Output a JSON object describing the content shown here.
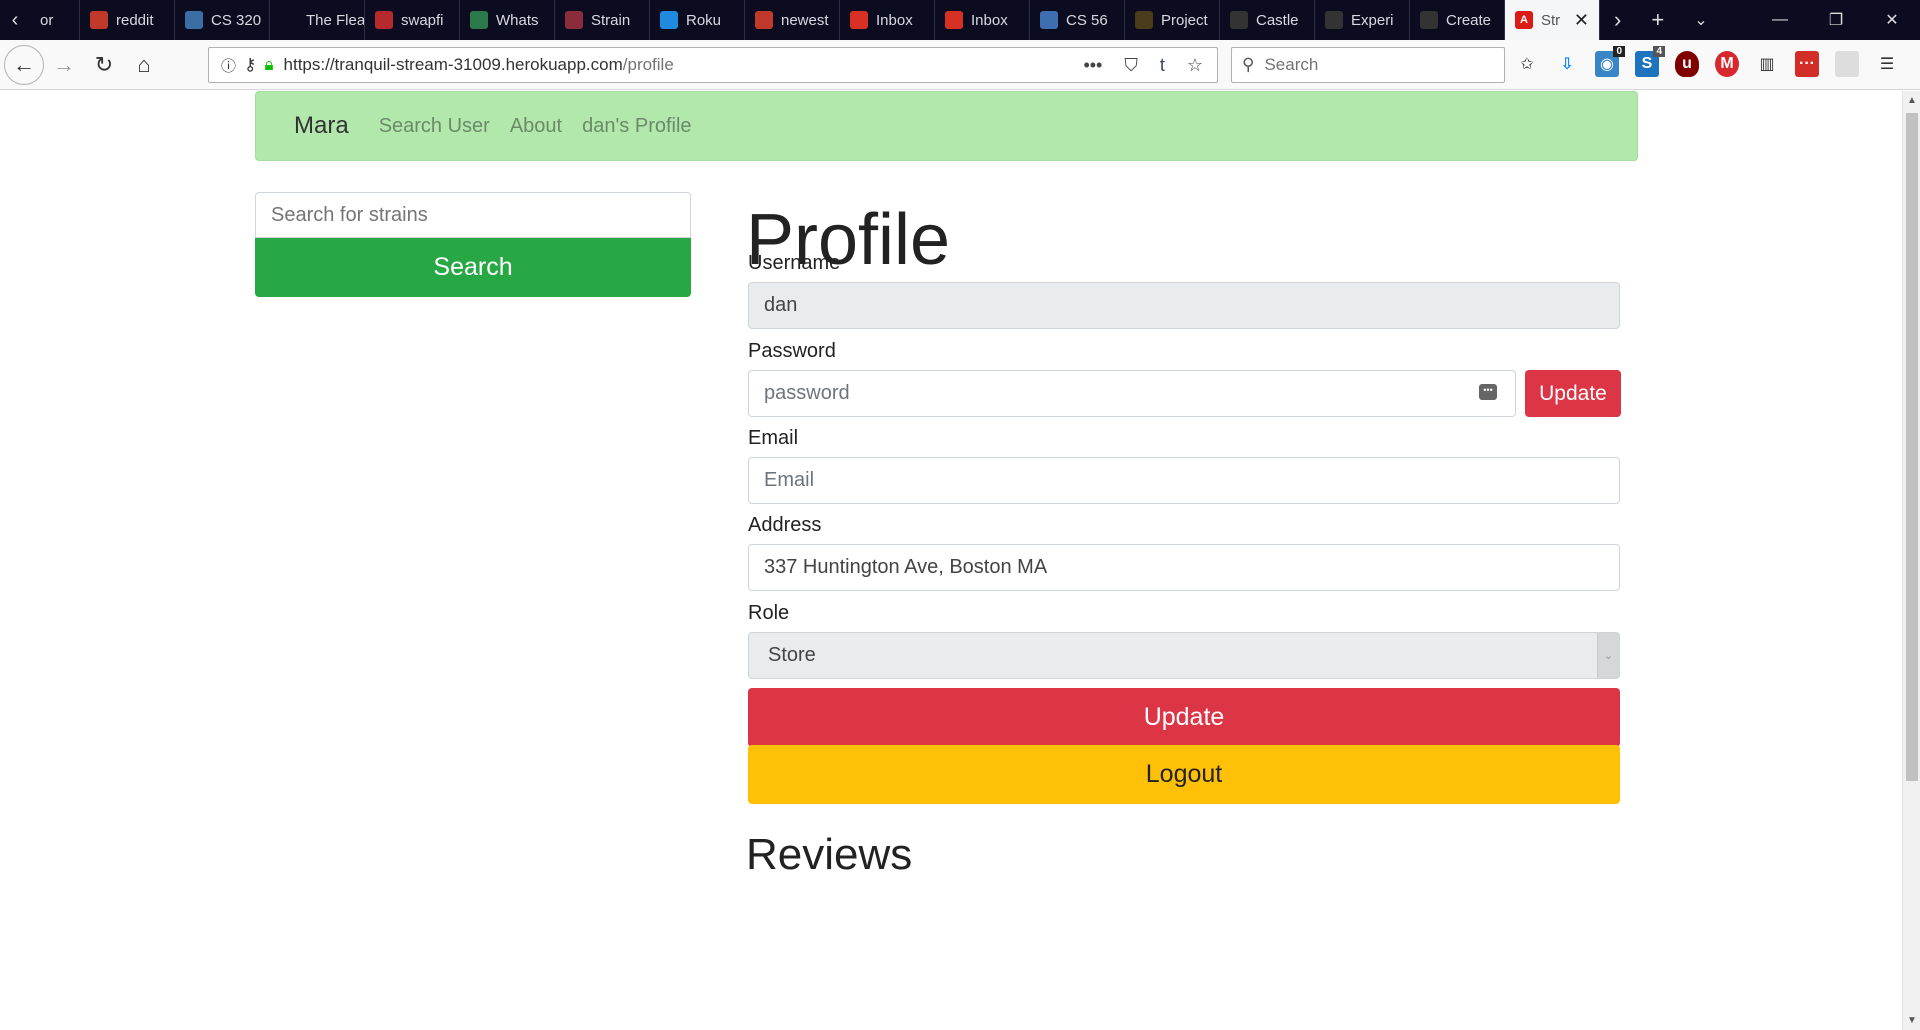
{
  "browser": {
    "tabs": [
      {
        "label": "or",
        "color": "#666"
      },
      {
        "label": "reddit",
        "color": "#c0392b"
      },
      {
        "label": "CS 320",
        "color": "#3b6ea5"
      },
      {
        "label": "The Flea at",
        "color": "#0c0c20"
      },
      {
        "label": "swapfi",
        "color": "#b52b2b"
      },
      {
        "label": "Whats",
        "color": "#2c7a4a"
      },
      {
        "label": "Strain",
        "color": "#8a2c3c"
      },
      {
        "label": "Roku",
        "color": "#1f8ae0"
      },
      {
        "label": "newest",
        "color": "#c0392b"
      },
      {
        "label": "Inbox",
        "color": "#d93025"
      },
      {
        "label": "Inbox",
        "color": "#d93025"
      },
      {
        "label": "CS 56",
        "color": "#3d6fb0"
      },
      {
        "label": "Project",
        "color": "#4a3b1a"
      },
      {
        "label": "Castle",
        "color": "#333"
      },
      {
        "label": "Experi",
        "color": "#333"
      },
      {
        "label": "Create",
        "color": "#333"
      }
    ],
    "active_tab": {
      "label": "Str",
      "color": "#dd1b16"
    },
    "url_host": "https://tranquil-stream-31009.herokuapp.com",
    "url_path": "/profile",
    "search_placeholder": "Search",
    "badge_counts": [
      "0",
      "4"
    ]
  },
  "site": {
    "brand": "Mara",
    "nav_links": [
      "Search User",
      "About",
      "dan's Profile"
    ],
    "strain_search_placeholder": "Search for strains",
    "strain_search_button": "Search"
  },
  "profile": {
    "title": "Profile",
    "username_label": "Username",
    "username_value": "dan",
    "password_label": "Password",
    "password_placeholder": "password",
    "password_update_button": "Update",
    "email_label": "Email",
    "email_placeholder": "Email",
    "address_label": "Address",
    "address_value": "337 Huntington Ave, Boston MA",
    "role_label": "Role",
    "role_value": "Store",
    "update_button": "Update",
    "logout_button": "Logout",
    "reviews_heading": "Reviews"
  }
}
